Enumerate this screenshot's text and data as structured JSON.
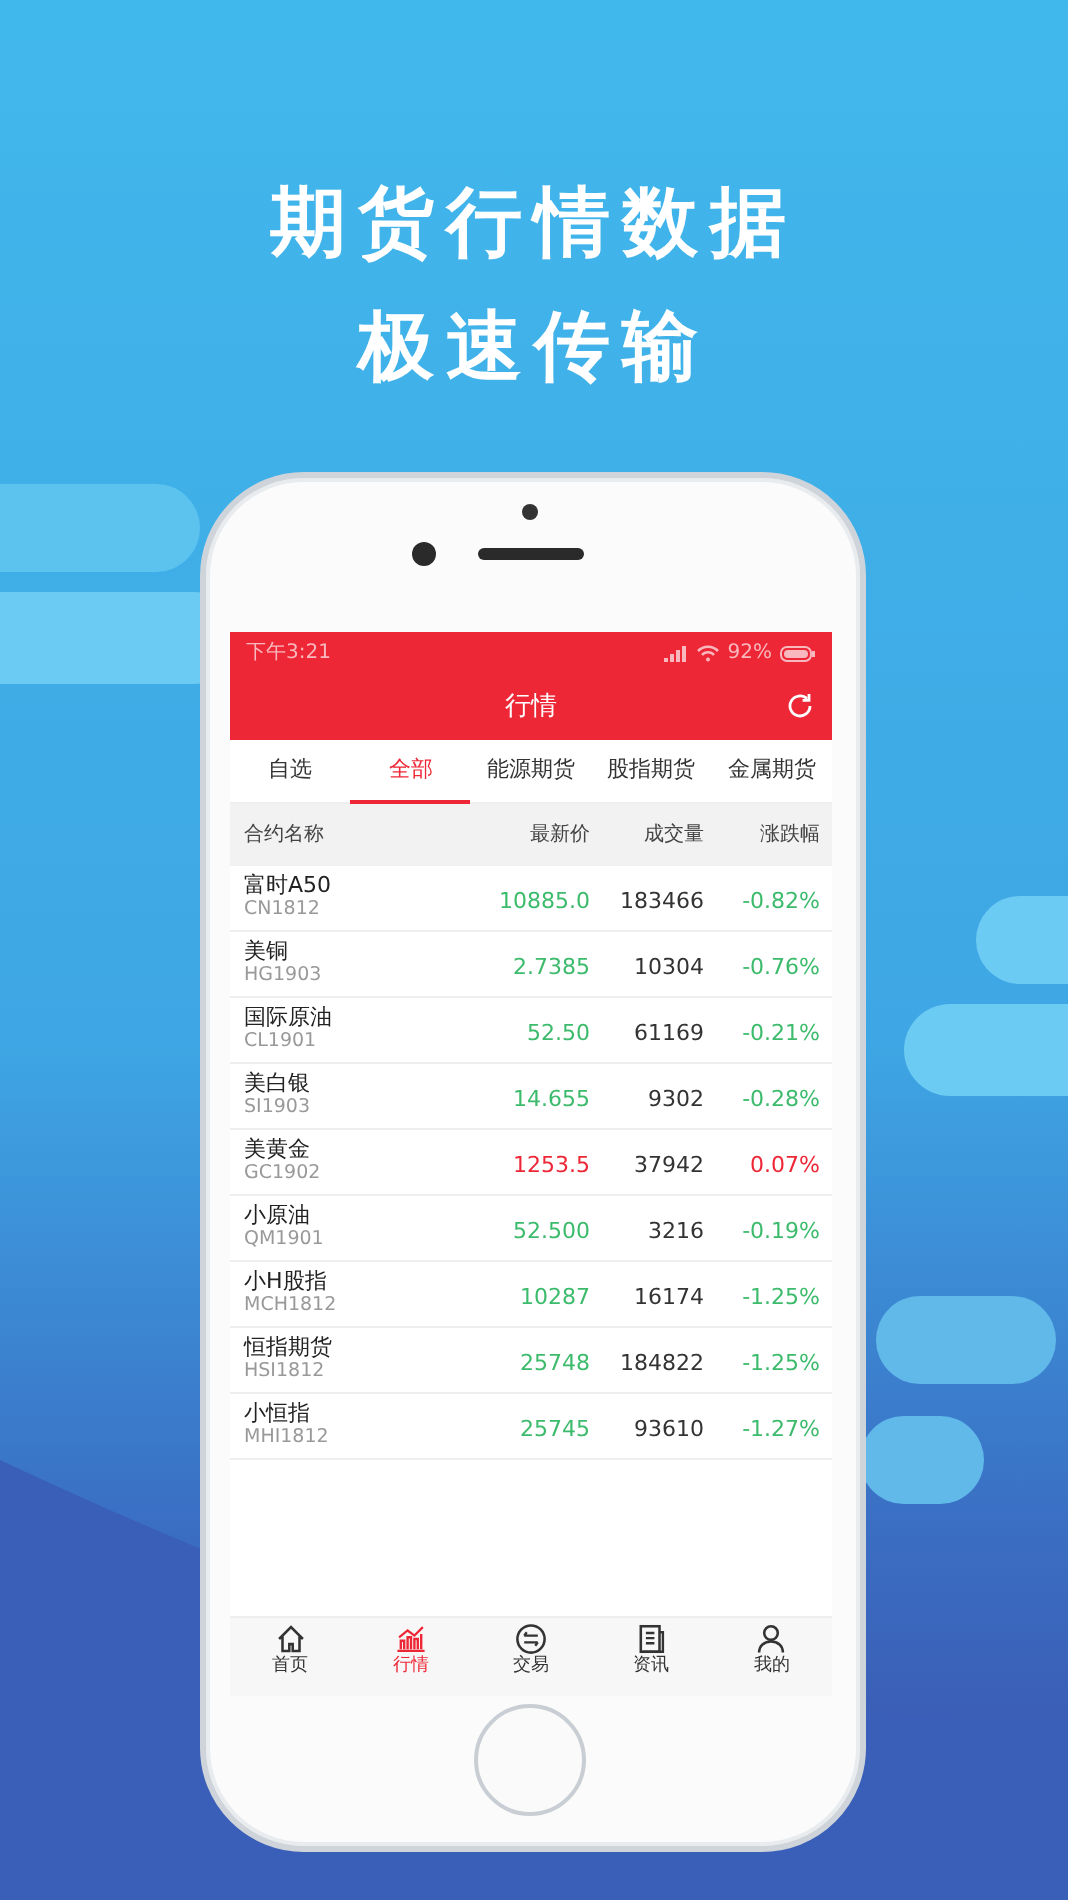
{
  "headline": [
    "期货行情数据",
    "极速传输"
  ],
  "status_bar": {
    "time": "下午3:21",
    "battery": "92%"
  },
  "title": "行情",
  "tabs": [
    {
      "label": "自选",
      "selected": false
    },
    {
      "label": "全部",
      "selected": true
    },
    {
      "label": "能源期货",
      "selected": false
    },
    {
      "label": "股指期货",
      "selected": false
    },
    {
      "label": "金属期货",
      "selected": false
    }
  ],
  "table": {
    "columns": [
      "合约名称",
      "最新价",
      "成交量",
      "涨跌幅"
    ],
    "rows": [
      {
        "name": "富时A50",
        "code": "CN1812",
        "price": "10885.0",
        "volume": "183466",
        "change": "-0.82%",
        "color": "#3dbb6c"
      },
      {
        "name": "美铜",
        "code": "HG1903",
        "price": "2.7385",
        "volume": "10304",
        "change": "-0.76%",
        "color": "#3dbb6c"
      },
      {
        "name": "国际原油",
        "code": "CL1901",
        "price": "52.50",
        "volume": "61169",
        "change": "-0.21%",
        "color": "#3dbb6c"
      },
      {
        "name": "美白银",
        "code": "SI1903",
        "price": "14.655",
        "volume": "9302",
        "change": "-0.28%",
        "color": "#3dbb6c"
      },
      {
        "name": "美黄金",
        "code": "GC1902",
        "price": "1253.5",
        "volume": "37942",
        "change": "0.07%",
        "color": "#ee2737"
      },
      {
        "name": "小原油",
        "code": "QM1901",
        "price": "52.500",
        "volume": "3216",
        "change": "-0.19%",
        "color": "#3dbb6c"
      },
      {
        "name": "小H股指",
        "code": "MCH1812",
        "price": "10287",
        "volume": "16174",
        "change": "-1.25%",
        "color": "#3dbb6c"
      },
      {
        "name": "恒指期货",
        "code": "HSI1812",
        "price": "25748",
        "volume": "184822",
        "change": "-1.25%",
        "color": "#3dbb6c"
      },
      {
        "name": "小恒指",
        "code": "MHI1812",
        "price": "25745",
        "volume": "93610",
        "change": "-1.27%",
        "color": "#3dbb6c"
      }
    ]
  },
  "bottom_nav": [
    {
      "label": "首页",
      "selected": false
    },
    {
      "label": "行情",
      "selected": true
    },
    {
      "label": "交易",
      "selected": false
    },
    {
      "label": "资讯",
      "selected": false
    },
    {
      "label": "我的",
      "selected": false
    }
  ]
}
